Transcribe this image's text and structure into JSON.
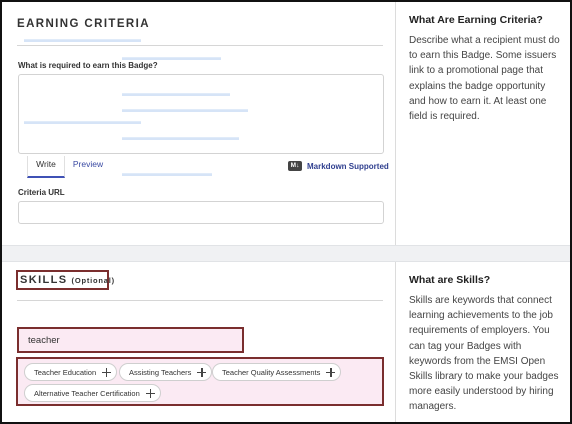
{
  "earning": {
    "heading": "EARNING CRITERIA",
    "field_label": "What is required to earn this Badge?",
    "textarea_value": "",
    "tabs": {
      "write": "Write",
      "preview": "Preview"
    },
    "markdown_icon_text": "M↓",
    "markdown_link": "Markdown Supported",
    "url_label": "Criteria URL",
    "url_value": "",
    "side_title": "What Are Earning Criteria?",
    "side_text": "Describe what a recipient must do to earn this Badge. Some issuers link to a promotional page that explains the badge opportunity and how to earn it. At least one field is required."
  },
  "skills": {
    "heading": "SKILLS",
    "optional": "(Optional)",
    "search_value": "teacher",
    "suggestions": [
      {
        "label": "Teacher Education"
      },
      {
        "label": "Assisting Teachers"
      },
      {
        "label": "Teacher Quality Assessments"
      },
      {
        "label": "Alternative Teacher Certification"
      }
    ],
    "side_title": "What are Skills?",
    "side_text": "Skills are keywords that connect learning achievements to the job requirements of employers. You can tag your Badges with keywords from the EMSI Open Skills library to make your badges more easily understood by hiring managers."
  }
}
